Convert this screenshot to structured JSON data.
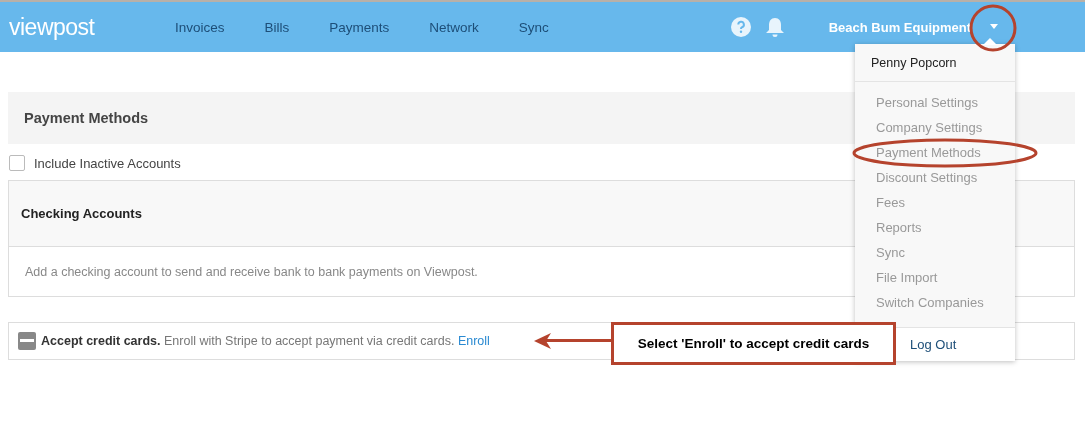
{
  "nav": {
    "logo": "viewpost",
    "items": [
      "Invoices",
      "Bills",
      "Payments",
      "Network",
      "Sync"
    ],
    "company": "Beach Bum Equipment"
  },
  "page": {
    "title": "Payment Methods",
    "include_inactive": {
      "label": "Include Inactive Accounts",
      "checked": false
    },
    "checking": {
      "title": "Checking Accounts",
      "message": "Add a checking account to send and receive bank to bank payments on Viewpost."
    },
    "credit": {
      "text": "**Accept credit cards.** Enroll with Stripe to accept payment via credit cards.",
      "link": "Enroll"
    }
  },
  "menu": {
    "user": "Penny Popcorn",
    "items": [
      "Personal Settings",
      "Company Settings",
      "Payment Methods",
      "Discount Settings",
      "Fees",
      "Reports",
      "Sync",
      "File Import",
      "Switch Companies"
    ],
    "logout": "Log Out"
  },
  "annotation": {
    "text": "Select 'Enroll' to accept credit cards"
  }
}
